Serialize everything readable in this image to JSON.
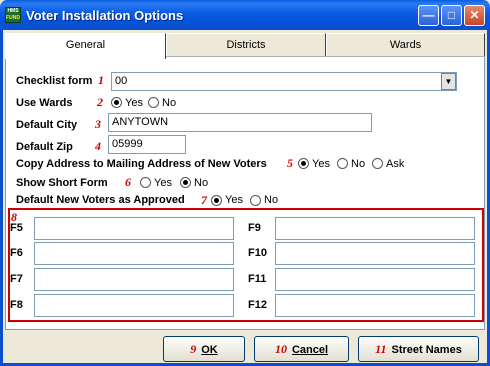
{
  "window": {
    "title": "Voter Installation Options",
    "icon_top": "HMS",
    "icon_bottom": "FUND"
  },
  "titlebar_buttons": {
    "minimize": "—",
    "maximize": "□",
    "close": "✕"
  },
  "tabs": [
    {
      "label": "General",
      "selected": true
    },
    {
      "label": "Districts",
      "selected": false
    },
    {
      "label": "Wards",
      "selected": false
    }
  ],
  "form": {
    "checklist": {
      "label": "Checklist form",
      "step": "1",
      "value": "00",
      "dropdown_glyph": "▼"
    },
    "use_wards": {
      "label": "Use Wards",
      "step": "2",
      "options": [
        "Yes",
        "No"
      ],
      "selected": "Yes"
    },
    "default_city": {
      "label": "Default City",
      "step": "3",
      "value": "ANYTOWN"
    },
    "default_zip": {
      "label": "Default Zip",
      "step": "4",
      "value": "05999"
    },
    "copy_address": {
      "label": "Copy Address to Mailing Address of New Voters",
      "step": "5",
      "options": [
        "Yes",
        "No",
        "Ask"
      ],
      "selected": "Yes"
    },
    "show_short_form": {
      "label": "Show Short Form",
      "step": "6",
      "options": [
        "Yes",
        "No"
      ],
      "selected": "No"
    },
    "approve_new": {
      "label": "Default New Voters as Approved",
      "step": "7",
      "options": [
        "Yes",
        "No"
      ],
      "selected": "Yes"
    }
  },
  "function_keys": {
    "step": "8",
    "left": [
      {
        "key": "F5",
        "value": ""
      },
      {
        "key": "F6",
        "value": ""
      },
      {
        "key": "F7",
        "value": ""
      },
      {
        "key": "F8",
        "value": ""
      }
    ],
    "right": [
      {
        "key": "F9",
        "value": ""
      },
      {
        "key": "F10",
        "value": ""
      },
      {
        "key": "F11",
        "value": ""
      },
      {
        "key": "F12",
        "value": ""
      }
    ]
  },
  "buttons": {
    "ok": {
      "step": "9",
      "label": "OK"
    },
    "cancel": {
      "step": "10",
      "label": "Cancel"
    },
    "street_names": {
      "step": "11",
      "label": "Street Names"
    }
  },
  "colors": {
    "accent_red": "#d10000",
    "title_blue": "#0a4fcc"
  }
}
